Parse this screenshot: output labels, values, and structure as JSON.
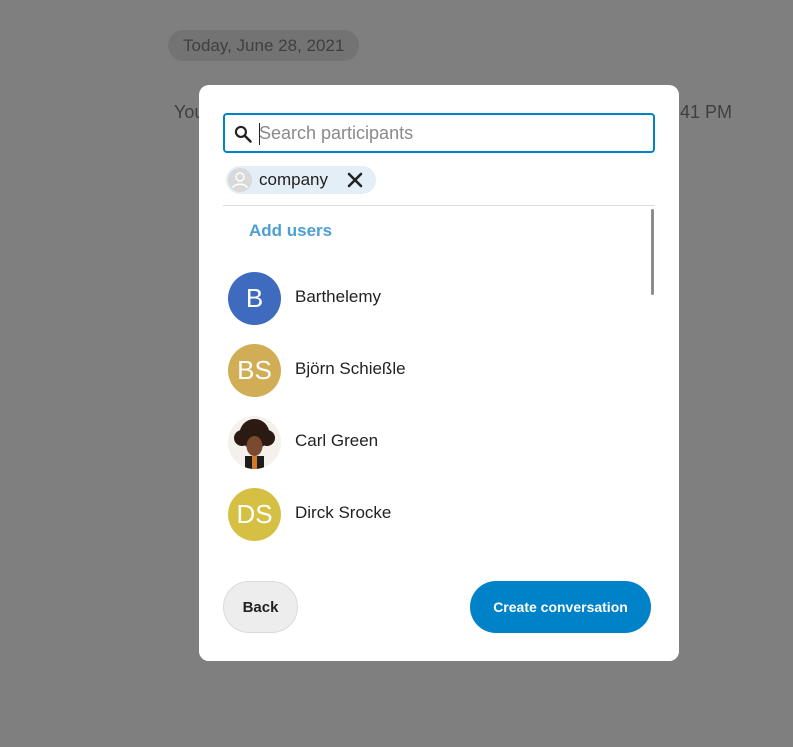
{
  "background": {
    "date_separator": "Today, June 28, 2021",
    "message_left": "You",
    "message_time": "41 PM"
  },
  "dialog": {
    "search": {
      "placeholder": "Search participants",
      "value": ""
    },
    "selected_chip": {
      "label": "company"
    },
    "add_users_label": "Add users",
    "users": [
      {
        "name": "Barthelemy",
        "initials": "B",
        "color": "#3e6bbd",
        "type": "initials"
      },
      {
        "name": "Björn Schießle",
        "initials": "BS",
        "color": "#d1ad56",
        "type": "initials"
      },
      {
        "name": "Carl Green",
        "initials": "",
        "color": "#caa78a",
        "type": "photo"
      },
      {
        "name": "Dirck Srocke",
        "initials": "DS",
        "color": "#d6c044",
        "type": "initials"
      },
      {
        "name": "",
        "initials": "",
        "color": "#9bbc74",
        "type": "photo"
      }
    ],
    "back_label": "Back",
    "create_label": "Create conversation"
  },
  "colors": {
    "accent": "#0082c9",
    "link": "#4b9fd5",
    "overlay": "#7f7f7f"
  }
}
